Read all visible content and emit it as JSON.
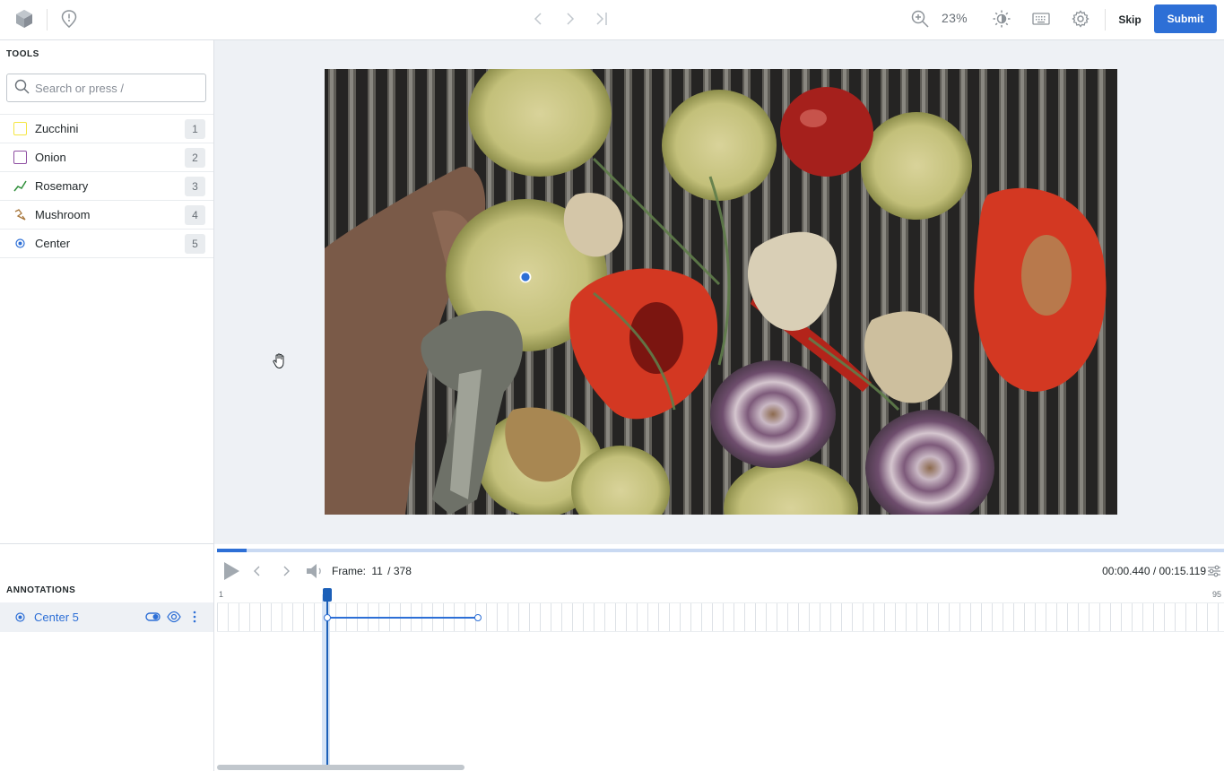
{
  "toolbar": {
    "zoom": "23%",
    "skip_label": "Skip",
    "submit_label": "Submit",
    "icons": [
      "logo-icon",
      "issue-icon",
      "prev-icon",
      "next-icon",
      "last-icon",
      "zoom-in-icon",
      "brightness-icon",
      "keyboard-icon",
      "settings-icon"
    ]
  },
  "tools": {
    "title": "TOOLS",
    "search_placeholder": "Search or press /",
    "items": [
      {
        "label": "Zucchini",
        "hotkey": "1",
        "color": "#f5e642",
        "icon": "bounding-box-icon"
      },
      {
        "label": "Onion",
        "hotkey": "2",
        "color": "#8e4ea1",
        "icon": "bounding-box-icon"
      },
      {
        "label": "Rosemary",
        "hotkey": "3",
        "color": "#2f8f3a",
        "icon": "polyline-icon"
      },
      {
        "label": "Mushroom",
        "hotkey": "4",
        "color": "#a8773c",
        "icon": "polygon-icon"
      },
      {
        "label": "Center",
        "hotkey": "5",
        "color": "#2d6fd6",
        "icon": "point-icon"
      }
    ]
  },
  "annotations": {
    "title": "ANNOTATIONS",
    "items": [
      {
        "label": "Center 5",
        "color": "#2d6fd6"
      }
    ]
  },
  "player": {
    "frame_prefix": "Frame:",
    "frame_current": "11",
    "frame_total": "/ 378",
    "time": "00:00.440 / 00:15.119",
    "ruler_start": "1",
    "ruler_end": "95",
    "progress": 0.029
  },
  "colors": {
    "accent": "#2d6fd6",
    "canvas_bg": "#eef1f5"
  }
}
